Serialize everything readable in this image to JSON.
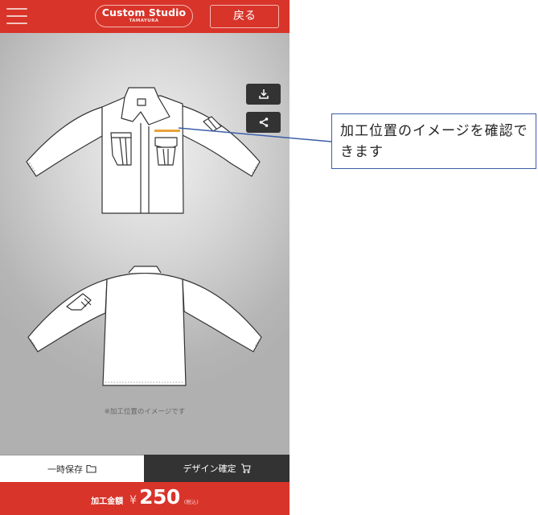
{
  "header": {
    "menu_icon": "hamburger-menu-icon",
    "logo_title": "Custom Studio",
    "logo_subtitle": "TAMAYURA",
    "back_label": "戻る",
    "background_color": "#d8342a"
  },
  "canvas": {
    "tools": [
      {
        "name": "download",
        "icon": "download-icon"
      },
      {
        "name": "share",
        "icon": "share-icon"
      }
    ],
    "views": [
      "front",
      "back"
    ],
    "note": "※加工位置のイメージです"
  },
  "actions": {
    "save_label": "一時保存",
    "save_icon": "folder-icon",
    "confirm_label": "デザイン確定",
    "confirm_icon": "cart-icon"
  },
  "price": {
    "label": "加工金額",
    "currency": "¥",
    "value": "250",
    "tax_note": "(税込)"
  },
  "callout": {
    "text": "加工位置のイメージを確認できます",
    "border_color": "#3b5ea8"
  }
}
